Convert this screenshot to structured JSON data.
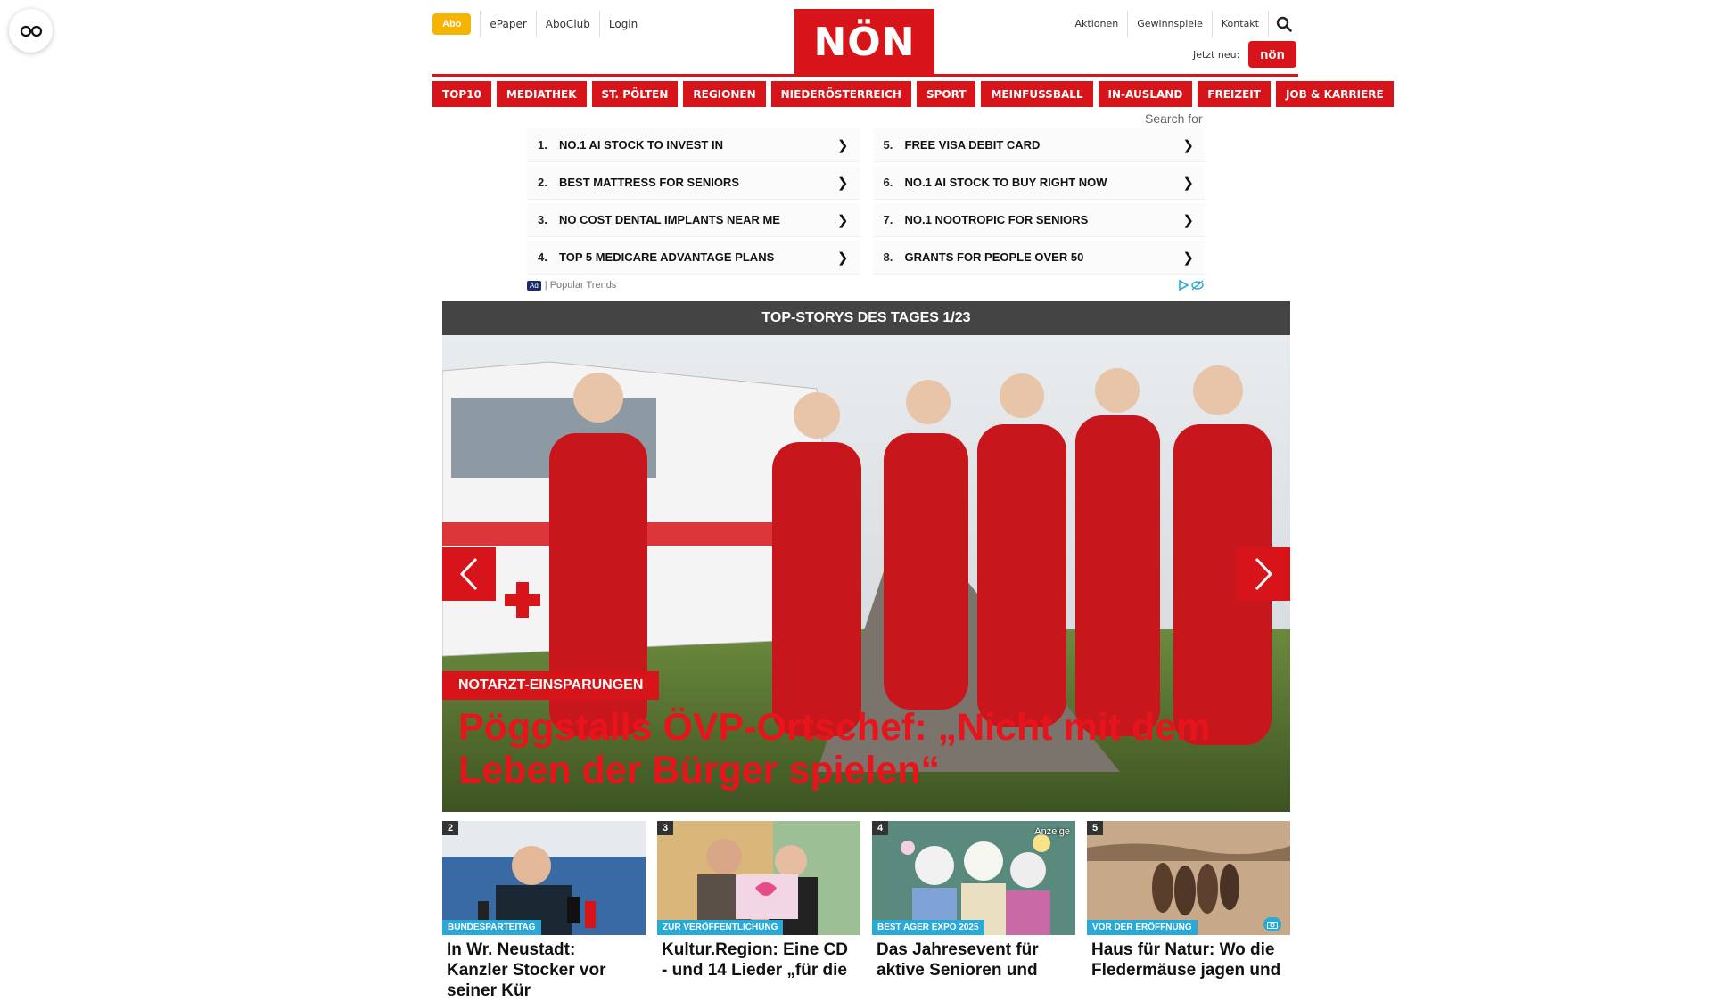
{
  "header": {
    "abo_label": "Abo",
    "left_links": [
      "ePaper",
      "AboClub",
      "Login"
    ],
    "logo_text": "NÖN",
    "right_links": [
      "Aktionen",
      "Gewinnspiele",
      "Kontakt"
    ],
    "jetzt_label": "Jetzt neu:",
    "badge_text": "nön"
  },
  "nav": {
    "items": [
      "TOP10",
      "MEDIATHEK",
      "ST. PÖLTEN",
      "REGIONEN",
      "NIEDERÖSTERREICH",
      "SPORT",
      "MEINFUSSBALL",
      "IN-AUSLAND",
      "FREIZEIT",
      "JOB & KARRIERE"
    ]
  },
  "ads": {
    "search_label": "Search for",
    "items": [
      {
        "num": "1.",
        "text": "NO.1 AI STOCK TO INVEST IN"
      },
      {
        "num": "5.",
        "text": "FREE VISA DEBIT CARD"
      },
      {
        "num": "2.",
        "text": "BEST MATTRESS FOR SENIORS"
      },
      {
        "num": "6.",
        "text": "NO.1 AI STOCK TO BUY RIGHT NOW"
      },
      {
        "num": "3.",
        "text": "NO COST DENTAL IMPLANTS NEAR ME"
      },
      {
        "num": "7.",
        "text": "NO.1 NOOTROPIC FOR SENIORS"
      },
      {
        "num": "4.",
        "text": "TOP 5 MEDICARE ADVANTAGE PLANS"
      },
      {
        "num": "8.",
        "text": "GRANTS FOR PEOPLE OVER 50"
      }
    ],
    "ad_tag": "Ad",
    "footer": "| Popular Trends"
  },
  "top_stories": {
    "title": "TOP-STORYS DES TAGES 1/23",
    "hero": {
      "kicker": "NOTARZT-EINSPARUNGEN",
      "headline": "Pöggstalls ÖVP-Ortschef: „Nicht mit dem Leben der Bürger spielen“"
    },
    "cards": [
      {
        "num": "2",
        "tag": "BUNDESPARTEITAG",
        "title": "In Wr. Neustadt: Kanzler Stocker vor seiner Kür",
        "anzeige": ""
      },
      {
        "num": "3",
        "tag": "ZUR VERÖFFENTLICHUNG",
        "title": "Kultur.Region: Eine CD - und 14 Lieder „für die",
        "anzeige": ""
      },
      {
        "num": "4",
        "tag": "BEST AGER EXPO 2025",
        "title": "Das Jahresevent für aktive Senioren und",
        "anzeige": "Anzeige"
      },
      {
        "num": "5",
        "tag": "VOR DER ERÖFFNUNG",
        "title": "Haus für Natur: Wo die Fledermäuse jagen und",
        "anzeige": ""
      }
    ]
  }
}
